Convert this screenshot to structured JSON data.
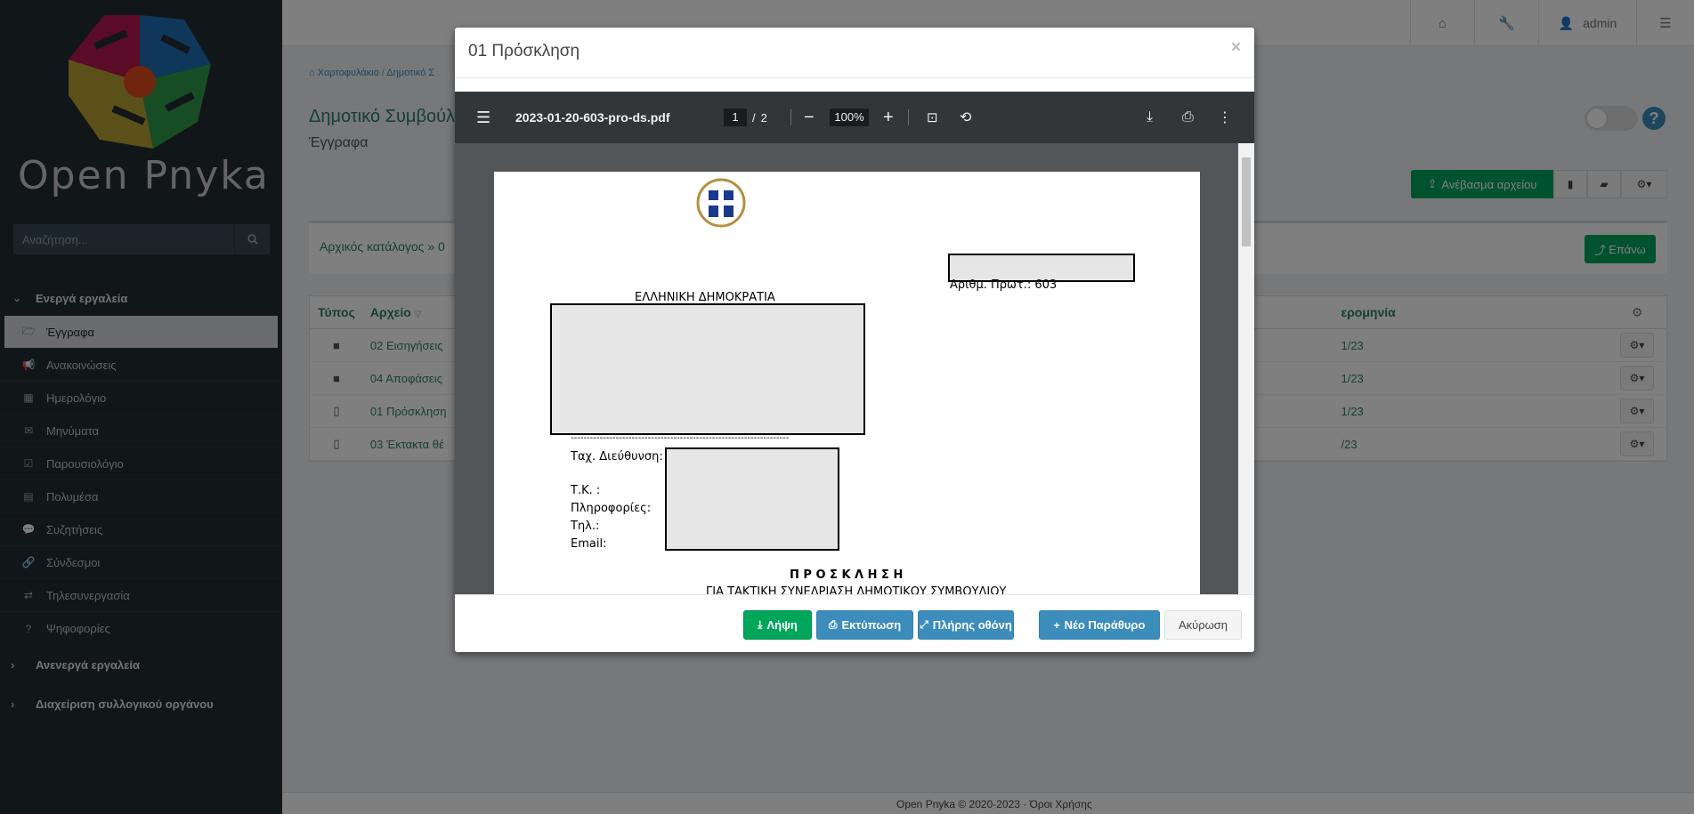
{
  "sidebar": {
    "logo_text": "Open Pnyka",
    "search_placeholder": "Αναζήτηση...",
    "active_tools_label": "Ενεργά εργαλεία",
    "items": [
      {
        "label": "Έγγραφα",
        "icon": "folder-open-icon"
      },
      {
        "label": "Ανακοινώσεις",
        "icon": "bullhorn-icon"
      },
      {
        "label": "Ημερολόγιο",
        "icon": "calendar-icon"
      },
      {
        "label": "Μηνύματα",
        "icon": "envelope-icon"
      },
      {
        "label": "Παρουσιολόγιο",
        "icon": "checkbox-icon"
      },
      {
        "label": "Πολυμέσα",
        "icon": "film-icon"
      },
      {
        "label": "Συζητήσεις",
        "icon": "comments-icon"
      },
      {
        "label": "Σύνδεσμοι",
        "icon": "link-icon"
      },
      {
        "label": "Τηλεσυνεργασία",
        "icon": "exchange-icon"
      },
      {
        "label": "Ψηφοφορίες",
        "icon": "question-circle-icon"
      }
    ],
    "inactive_tools_label": "Ανενεργά εργαλεία",
    "admin_label": "Διαχείριση συλλογικού οργάνου"
  },
  "topbar": {
    "user": "admin"
  },
  "content": {
    "breadcrumb_home": "Χαρτοφυλάκιο",
    "breadcrumb_course": "Δημοτικό Σ",
    "page_title": "Δημοτικό Συμβούλ",
    "page_subtitle": "Έγγραφα",
    "upload_label": "Ανέβασμα αρχείου",
    "dir_path": "Αρχικός κατάλογος » 0",
    "up_label": "Επάνω",
    "table": {
      "col_type": "Τύπος",
      "col_file": "Αρχείο",
      "col_date": "ερομηνία",
      "rows": [
        {
          "type": "folder",
          "name": "02 Εισηγήσεις",
          "date": "1/23"
        },
        {
          "type": "folder",
          "name": "04 Αποφάσεις",
          "date": "1/23"
        },
        {
          "type": "pdf",
          "name": "01 Πρόσκληση",
          "date": "1/23"
        },
        {
          "type": "pdf",
          "name": "03 Έκτακτα θέ",
          "date": "/23"
        }
      ]
    },
    "footer": "Open Pnyka © 2020-2023 · Όροι Χρήσης"
  },
  "modal": {
    "title": "01 Πρόσκληση",
    "close": "×",
    "viewer": {
      "filename": "2023-01-20-603-pro-ds.pdf",
      "current_page": "1",
      "page_sep": "/",
      "total_pages": "2",
      "zoom": "100%"
    },
    "pdf": {
      "republic": "ΕΛΛΗΝΙΚΗ ΔΗΜΟΚΡΑΤΙΑ",
      "protocol": "Αριθμ. Πρωτ.:  603",
      "dashes": "--------------------------------------------------------------------",
      "address": "Ταχ. Διεύθυνση:",
      "tk": "Τ.Κ. :",
      "info": "Πληροφορίες:",
      "phone": "Τηλ.:",
      "email": "Email:",
      "invitation": "Π Ρ Ο Σ Κ Λ Η Σ Η",
      "invitation_sub": "ΓΙΑ ΤΑΚΤΙΚΗ ΣΥΝΕΔΡΙΑΣΗ ΔΗΜΟΤΙΚΟΥ ΣΥΜΒΟΥΛΙΟΥ"
    },
    "buttons": {
      "download": "Λήψη",
      "print": "Εκτύπωση",
      "fullscreen": "Πλήρης οθόνη",
      "new_window": "Νέο Παράθυρο",
      "cancel": "Ακύρωση"
    }
  },
  "colors": {
    "sidebar_bg": "#222d32",
    "accent_green": "#00a65a",
    "accent_blue": "#3c8dbc",
    "title_teal": "#2d7d6b"
  }
}
